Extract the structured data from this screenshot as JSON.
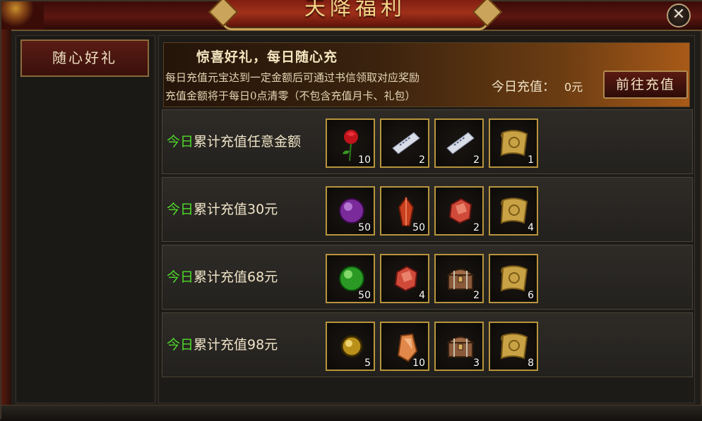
{
  "window": {
    "title": "天降福利",
    "close_label": "✕"
  },
  "sidebar": {
    "tabs": [
      {
        "label": "随心好礼",
        "active": true
      }
    ]
  },
  "banner": {
    "title": "惊喜好礼，每日随心充",
    "line1": "每日充值元宝达到一定金额后可通过书信领取对应奖励",
    "line2": "充值金额将于每日0点清零（不包含充值月卡、礼包）",
    "today_label": "今日充值：",
    "today_value": "0元",
    "button_label": "前往充值"
  },
  "rows": [
    {
      "prefix": "今日",
      "rest": "累计充值任意金额",
      "items": [
        {
          "icon": "rose-icon",
          "count": "10"
        },
        {
          "icon": "ticket-icon",
          "count": "2"
        },
        {
          "icon": "ticket-icon",
          "count": "2"
        },
        {
          "icon": "scroll-icon",
          "count": "1"
        }
      ]
    },
    {
      "prefix": "今日",
      "rest": "累计充值30元",
      "items": [
        {
          "icon": "purple-orb-icon",
          "count": "50"
        },
        {
          "icon": "red-crystal-icon",
          "count": "50"
        },
        {
          "icon": "red-gem-icon",
          "count": "2"
        },
        {
          "icon": "scroll-icon",
          "count": "4"
        }
      ]
    },
    {
      "prefix": "今日",
      "rest": "累计充值68元",
      "items": [
        {
          "icon": "green-orb-icon",
          "count": "50"
        },
        {
          "icon": "red-gem-icon",
          "count": "4"
        },
        {
          "icon": "treasure-chest-icon",
          "count": "2"
        },
        {
          "icon": "scroll-icon",
          "count": "6"
        }
      ]
    },
    {
      "prefix": "今日",
      "rest": "累计充值98元",
      "items": [
        {
          "icon": "gold-orb-icon",
          "count": "5"
        },
        {
          "icon": "orange-crystal-icon",
          "count": "10"
        },
        {
          "icon": "treasure-chest-icon",
          "count": "3"
        },
        {
          "icon": "scroll-icon",
          "count": "8"
        }
      ]
    }
  ],
  "colors": {
    "highlight_green": "#4fdc2a",
    "slot_border": "#b8953c",
    "title_gold": "#f3d58a"
  }
}
